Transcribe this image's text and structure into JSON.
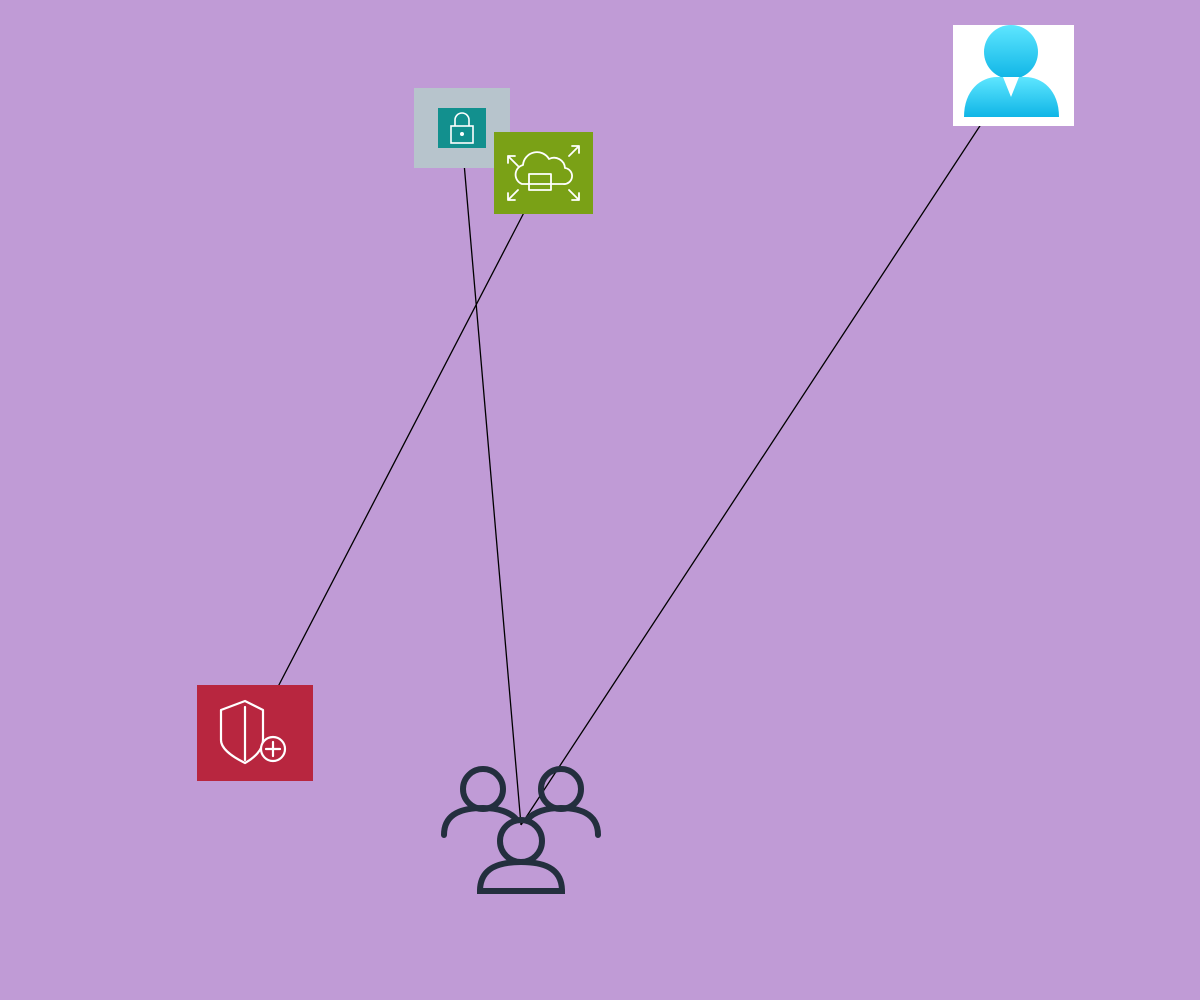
{
  "diagram": {
    "background_color": "#c09bd6",
    "nodes": [
      {
        "id": "iam-lock",
        "icon": "lock-icon",
        "tile_color": "#b7c4cc",
        "inner_color": "#12908e"
      },
      {
        "id": "cloud-expand",
        "icon": "cloud-expand-icon",
        "tile_color": "#7aa116"
      },
      {
        "id": "user-azure",
        "icon": "user-icon",
        "tile_color": "#ffffff",
        "figure_color": "#1ecbf0"
      },
      {
        "id": "shield-add",
        "icon": "shield-add-icon",
        "tile_color": "#b8263f"
      },
      {
        "id": "user-group",
        "icon": "users-group-icon",
        "figure_color": "#232f3e"
      }
    ],
    "edges": [
      {
        "from": "shield-add",
        "to": "cloud-expand"
      },
      {
        "from": "cloud-expand",
        "to": "iam-lock"
      },
      {
        "from": "user-group",
        "to": "iam-lock"
      },
      {
        "from": "user-group",
        "to": "user-azure"
      }
    ],
    "edge_color": "#000000"
  }
}
